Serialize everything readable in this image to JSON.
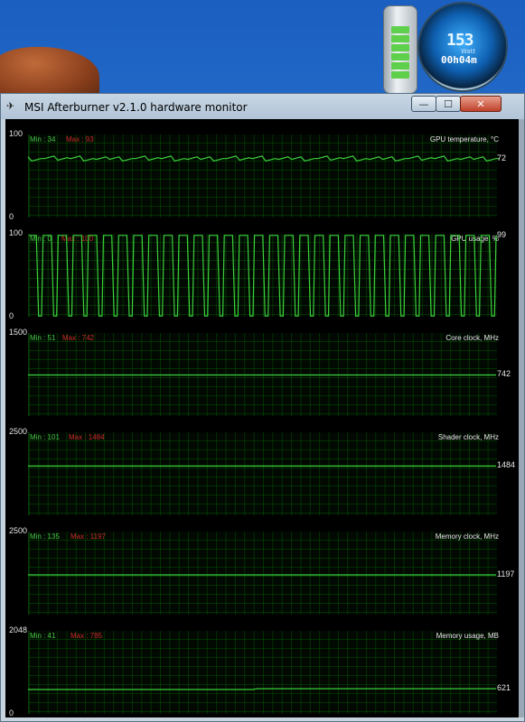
{
  "window": {
    "title": "MSI Afterburner v2.1.0 hardware monitor"
  },
  "gadget": {
    "value": "153",
    "unit": "Watt",
    "time": "00h04m"
  },
  "graphs": [
    {
      "title": "GPU temperature, °C",
      "ymax": "100",
      "ymin": "0",
      "min_label": "Min : 34",
      "max_label": "Max : 93",
      "current": "72"
    },
    {
      "title": "GPU usage, %",
      "ymax": "100",
      "ymin": "0",
      "min_label": "Min : 0",
      "max_label": "Max : 100",
      "current": "99"
    },
    {
      "title": "Core clock, MHz",
      "ymax": "1500",
      "ymin": "",
      "min_label": "Min : 51",
      "max_label": "Max : 742",
      "current": "742"
    },
    {
      "title": "Shader clock, MHz",
      "ymax": "2500",
      "ymin": "",
      "min_label": "Min : 101",
      "max_label": "Max : 1484",
      "current": "1484"
    },
    {
      "title": "Memory clock, MHz",
      "ymax": "2500",
      "ymin": "",
      "min_label": "Min : 135",
      "max_label": "Max : 1197",
      "current": "1197"
    },
    {
      "title": "Memory usage, MB",
      "ymax": "2048",
      "ymin": "0",
      "min_label": "Min : 41",
      "max_label": "Max : 785",
      "current": "621"
    }
  ],
  "chart_data": [
    {
      "type": "line",
      "title": "GPU temperature, °C",
      "ylim": [
        0,
        100
      ],
      "series": [
        {
          "name": "GPU temperature",
          "values": [
            72,
            70,
            73,
            71,
            73,
            70,
            72
          ]
        }
      ]
    },
    {
      "type": "line",
      "title": "GPU usage, %",
      "ylim": [
        0,
        100
      ],
      "series": [
        {
          "name": "GPU usage",
          "values": [
            99,
            0,
            99,
            0,
            99,
            0,
            99
          ]
        }
      ]
    },
    {
      "type": "line",
      "title": "Core clock, MHz",
      "ylim": [
        0,
        1500
      ],
      "series": [
        {
          "name": "Core clock",
          "values": [
            742,
            742,
            742
          ]
        }
      ]
    },
    {
      "type": "line",
      "title": "Shader clock, MHz",
      "ylim": [
        0,
        2500
      ],
      "series": [
        {
          "name": "Shader clock",
          "values": [
            1484,
            1484,
            1484
          ]
        }
      ]
    },
    {
      "type": "line",
      "title": "Memory clock, MHz",
      "ylim": [
        0,
        2500
      ],
      "series": [
        {
          "name": "Memory clock",
          "values": [
            1197,
            1197,
            1197
          ]
        }
      ]
    },
    {
      "type": "line",
      "title": "Memory usage, MB",
      "ylim": [
        0,
        2048
      ],
      "series": [
        {
          "name": "Memory usage",
          "values": [
            600,
            600,
            621,
            621
          ]
        }
      ]
    }
  ],
  "colors": {
    "line": "#3bd13b",
    "min_text": "#48c548",
    "max_text": "#cc2a2a"
  }
}
